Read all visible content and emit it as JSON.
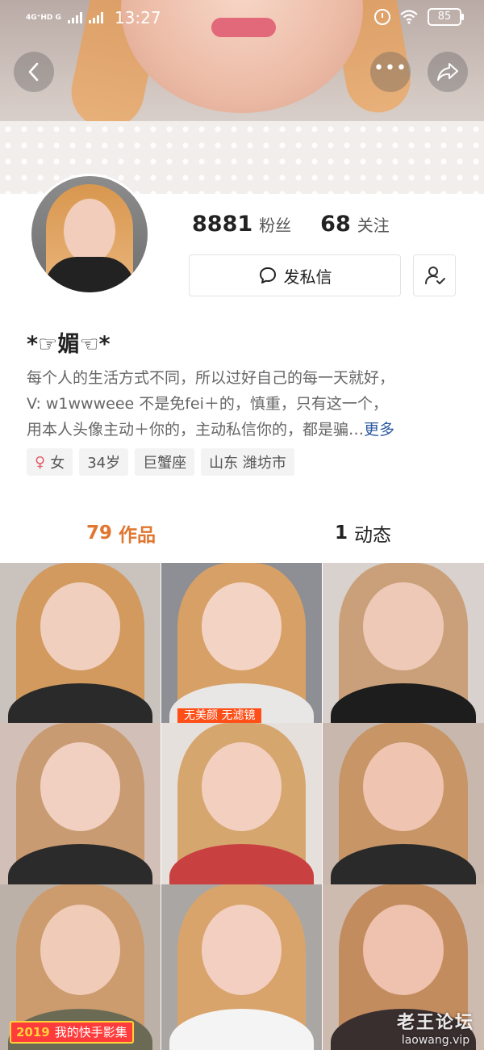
{
  "status_bar": {
    "network": "4G⁺HD G",
    "time": "13:27",
    "battery": "85"
  },
  "profile": {
    "fans_count": "8881",
    "fans_label": "粉丝",
    "following_count": "68",
    "following_label": "关注",
    "message_button": "发私信",
    "nickname": "*☞媚☜*",
    "bio_lines": [
      "每个人的生活方式不同，所以过好自己的每一天就好，",
      "V:   w1wwweee  不是免fei＋的，慎重，只有这一个，",
      "用本人头像主动＋你的，主动私信你的，都是骗…"
    ],
    "bio_more": "更多",
    "tags": [
      "女",
      "34岁",
      "巨蟹座",
      "山东 潍坊市"
    ]
  },
  "tabs": [
    {
      "count": "79",
      "label": "作品",
      "active": true
    },
    {
      "count": "1",
      "label": "动态",
      "active": false
    }
  ],
  "grid": {
    "overlay_text": "无美颜  无滤镜",
    "collection_year": "2019",
    "collection_label": "我的快手影集"
  },
  "watermark": {
    "title": "老王论坛",
    "url": "laowang.vip"
  },
  "colors": {
    "accent_orange": "#e0762f",
    "link_blue": "#2c5aa0"
  }
}
